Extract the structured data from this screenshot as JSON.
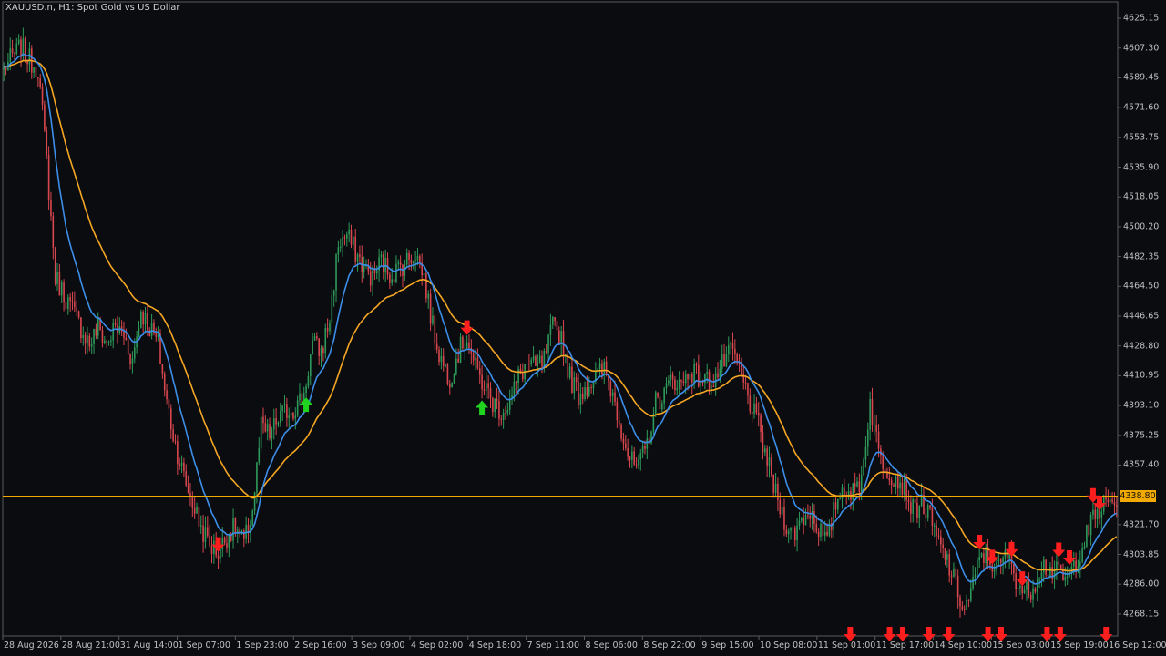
{
  "window": {
    "title": "XAUUSD.n, H1:  Spot Gold vs US Dollar"
  },
  "colors": {
    "background": "#0a0c10",
    "axis": "#5a5a5a",
    "bull": "#2e9a5a",
    "bear": "#d9474e",
    "ma_fast": "#3d8ee8",
    "ma_slow": "#f5a623",
    "price_line": "#f2a900",
    "arrow_buy": "#1fd31f",
    "arrow_sell": "#ff1e1e"
  },
  "chart_data": {
    "type": "candlestick",
    "symbol": "XAUUSD.n",
    "timeframe": "H1",
    "description": "Spot Gold vs US Dollar",
    "y_ticks": [
      "4625.15",
      "4607.30",
      "4589.45",
      "4571.60",
      "4553.75",
      "4535.90",
      "4518.05",
      "4500.20",
      "4482.35",
      "4464.50",
      "4446.65",
      "4428.80",
      "4410.95",
      "4393.10",
      "4375.25",
      "4357.40",
      "4321.70",
      "4303.85",
      "4286.00",
      "4268.15"
    ],
    "ylim": [
      4255.0,
      4635.0
    ],
    "x_ticks": [
      "28 Aug 2026",
      "28 Aug 21:00",
      "31 Aug 14:00",
      "1 Sep 07:00",
      "1 Sep 23:00",
      "2 Sep 16:00",
      "3 Sep 09:00",
      "4 Sep 02:00",
      "4 Sep 18:00",
      "7 Sep 11:00",
      "8 Sep 06:00",
      "8 Sep 22:00",
      "9 Sep 15:00",
      "10 Sep 08:00",
      "11 Sep 01:00",
      "11 Sep 17:00",
      "14 Sep 10:00",
      "15 Sep 03:00",
      "15 Sep 19:00",
      "16 Sep 12:00"
    ],
    "current_price": "4338.80",
    "close_anchors": [
      [
        0,
        4595
      ],
      [
        4,
        4602
      ],
      [
        8,
        4608
      ],
      [
        12,
        4600
      ],
      [
        16,
        4595
      ],
      [
        20,
        4540
      ],
      [
        24,
        4470
      ],
      [
        28,
        4460
      ],
      [
        32,
        4450
      ],
      [
        36,
        4440
      ],
      [
        40,
        4430
      ],
      [
        44,
        4440
      ],
      [
        48,
        4430
      ],
      [
        52,
        4440
      ],
      [
        56,
        4435
      ],
      [
        60,
        4420
      ],
      [
        64,
        4450
      ],
      [
        68,
        4440
      ],
      [
        72,
        4430
      ],
      [
        76,
        4395
      ],
      [
        80,
        4370
      ],
      [
        84,
        4350
      ],
      [
        88,
        4335
      ],
      [
        92,
        4320
      ],
      [
        96,
        4310
      ],
      [
        100,
        4305
      ],
      [
        104,
        4315
      ],
      [
        108,
        4320
      ],
      [
        112,
        4310
      ],
      [
        116,
        4330
      ],
      [
        120,
        4380
      ],
      [
        124,
        4375
      ],
      [
        128,
        4385
      ],
      [
        132,
        4390
      ],
      [
        136,
        4392
      ],
      [
        140,
        4400
      ],
      [
        144,
        4430
      ],
      [
        148,
        4425
      ],
      [
        152,
        4445
      ],
      [
        156,
        4490
      ],
      [
        160,
        4495
      ],
      [
        164,
        4485
      ],
      [
        168,
        4475
      ],
      [
        172,
        4470
      ],
      [
        176,
        4480
      ],
      [
        180,
        4472
      ],
      [
        184,
        4475
      ],
      [
        188,
        4480
      ],
      [
        192,
        4485
      ],
      [
        196,
        4470
      ],
      [
        200,
        4440
      ],
      [
        204,
        4420
      ],
      [
        208,
        4410
      ],
      [
        212,
        4425
      ],
      [
        216,
        4435
      ],
      [
        220,
        4415
      ],
      [
        224,
        4405
      ],
      [
        228,
        4395
      ],
      [
        232,
        4390
      ],
      [
        236,
        4395
      ],
      [
        240,
        4410
      ],
      [
        244,
        4418
      ],
      [
        248,
        4415
      ],
      [
        252,
        4420
      ],
      [
        256,
        4440
      ],
      [
        260,
        4435
      ],
      [
        264,
        4410
      ],
      [
        268,
        4400
      ],
      [
        272,
        4405
      ],
      [
        276,
        4410
      ],
      [
        280,
        4415
      ],
      [
        284,
        4400
      ],
      [
        288,
        4380
      ],
      [
        292,
        4360
      ],
      [
        296,
        4355
      ],
      [
        300,
        4370
      ],
      [
        304,
        4395
      ],
      [
        308,
        4400
      ],
      [
        312,
        4410
      ],
      [
        316,
        4405
      ],
      [
        320,
        4415
      ],
      [
        324,
        4410
      ],
      [
        328,
        4408
      ],
      [
        332,
        4410
      ],
      [
        336,
        4420
      ],
      [
        340,
        4425
      ],
      [
        344,
        4410
      ],
      [
        348,
        4395
      ],
      [
        352,
        4380
      ],
      [
        356,
        4360
      ],
      [
        360,
        4340
      ],
      [
        364,
        4325
      ],
      [
        368,
        4315
      ],
      [
        372,
        4325
      ],
      [
        376,
        4330
      ],
      [
        380,
        4320
      ],
      [
        384,
        4310
      ],
      [
        388,
        4335
      ],
      [
        392,
        4345
      ],
      [
        396,
        4340
      ],
      [
        400,
        4350
      ],
      [
        404,
        4395
      ],
      [
        408,
        4365
      ],
      [
        412,
        4355
      ],
      [
        416,
        4350
      ],
      [
        420,
        4345
      ],
      [
        424,
        4330
      ],
      [
        428,
        4335
      ],
      [
        432,
        4325
      ],
      [
        436,
        4310
      ],
      [
        440,
        4300
      ],
      [
        444,
        4285
      ],
      [
        448,
        4270
      ],
      [
        452,
        4285
      ],
      [
        456,
        4305
      ],
      [
        460,
        4300
      ],
      [
        464,
        4295
      ],
      [
        468,
        4305
      ],
      [
        472,
        4290
      ],
      [
        476,
        4280
      ],
      [
        480,
        4285
      ],
      [
        484,
        4298
      ],
      [
        488,
        4295
      ],
      [
        492,
        4292
      ],
      [
        496,
        4288
      ],
      [
        500,
        4300
      ],
      [
        504,
        4312
      ],
      [
        508,
        4325
      ],
      [
        512,
        4332
      ],
      [
        516,
        4335
      ]
    ],
    "arrows": [
      {
        "type": "sell",
        "bar": 100
      },
      {
        "type": "buy",
        "bar": 141
      },
      {
        "type": "sell",
        "bar": 216
      },
      {
        "type": "buy",
        "bar": 223
      },
      {
        "type": "sell",
        "bar": 455
      },
      {
        "type": "sell",
        "bar": 461
      },
      {
        "type": "sell",
        "bar": 470
      },
      {
        "type": "sell",
        "bar": 475
      },
      {
        "type": "sell",
        "bar": 492
      },
      {
        "type": "sell",
        "bar": 497
      },
      {
        "type": "sell",
        "bar": 508
      },
      {
        "type": "sell",
        "bar": 511
      }
    ],
    "bottom_arrows": [
      258,
      270,
      274,
      282,
      288,
      300,
      304,
      318,
      322,
      336
    ]
  }
}
